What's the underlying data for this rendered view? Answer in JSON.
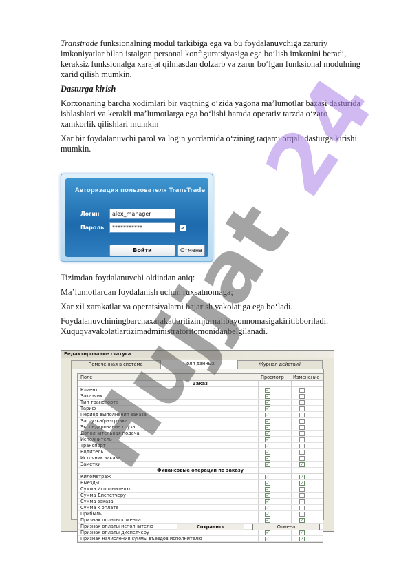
{
  "intro": {
    "term": "Transtrade",
    "rest": " funksionalning modul tarkibiga ega va bu foydalanuvchiga zaruriy imkoniyatlar bilan istalgan personal konfiguratsiyasiga ega bo‘lish imkonini beradi, keraksiz funksionalga xarajat qilmasdan dolzarb va zarur bo‘lgan funksional modulning xarid qilish mumkin."
  },
  "heading": "Dasturga kirish",
  "para1": "Korxonaning barcha xodimlari bir vaqtning o‘zida yagona ma’lumotlar bazasi dasturida ishlashlari va kerakli ma’lumotlarga ega bo‘lishi hamda operativ tarzda o‘zaro xamkorlik qilishlari mumkin",
  "para2": "Xar bir foydalanuvchi parol va login yordamida o‘zining  raqami orqali dasturga kirishi mumkin.",
  "login": {
    "title": "Авторизация пользователя TransTrade",
    "login_label": "Логин",
    "login_value": "alex_manager",
    "password_label": "Пароль",
    "password_value": "***********",
    "check_mark": "✔",
    "ok_label": "Войти",
    "cancel_label": "Отмена"
  },
  "para3": "Tizimdan foydalanuvchi oldindan aniq:",
  "para4": "Ma’lumotlardan foydalanish uchun  ruxsatnomaga;",
  "para5": " Xar xil xarakatlar va operatsiyalarni bajarish vakolatiga ega bo‘ladi.",
  "para6": " Foydalanuvchiningbarchaxarakatlaritizimjurnalibayonnomasigakiritibboriladi. Xuquqvavakolatlartizimadministratoritomonidanbelgilanadi.",
  "editor": {
    "title": "Редактирование статуса",
    "tabs": [
      "Помеченная в системе",
      "Поля данных",
      "Журнал действий"
    ],
    "col_field": "Поле",
    "col_view": "Просмотр",
    "col_edit": "Изменение",
    "section1": "Заказ",
    "rows1": [
      {
        "name": "Клиент",
        "view": true,
        "edit": false
      },
      {
        "name": "Заказчик",
        "view": true,
        "edit": false
      },
      {
        "name": "Тип транспорта",
        "view": true,
        "edit": false
      },
      {
        "name": "Тариф",
        "view": true,
        "edit": false
      },
      {
        "name": "Период выполнения заказа",
        "view": true,
        "edit": false
      },
      {
        "name": "Загрузка/разгрузка",
        "view": true,
        "edit": false
      },
      {
        "name": "Экспедирование груза",
        "view": true,
        "edit": false
      },
      {
        "name": "Дополнительная подача",
        "view": true,
        "edit": false
      },
      {
        "name": "Исполнитель",
        "view": true,
        "edit": false
      },
      {
        "name": "Транспорт",
        "view": true,
        "edit": false
      },
      {
        "name": "Водитель",
        "view": true,
        "edit": false
      },
      {
        "name": "Источник заказа",
        "view": true,
        "edit": false
      },
      {
        "name": "Заметки",
        "view": true,
        "edit": true
      }
    ],
    "section2": "Финансовые операции по заказу",
    "rows2": [
      {
        "name": "Километраж",
        "view": true,
        "edit": true
      },
      {
        "name": "Выезды",
        "view": true,
        "edit": true
      },
      {
        "name": "Сумма Исполнителю",
        "view": true,
        "edit": false
      },
      {
        "name": "Сумма Диспетчеру",
        "view": true,
        "edit": false
      },
      {
        "name": "Сумма заказа",
        "view": true,
        "edit": false
      },
      {
        "name": "Сумма к оплате",
        "view": true,
        "edit": false
      },
      {
        "name": "Прибыль",
        "view": true,
        "edit": false
      },
      {
        "name": "Признак оплаты клиента",
        "view": true,
        "edit": true
      },
      {
        "name": "Признак оплаты исполнителю",
        "view": true,
        "edit": true
      },
      {
        "name": "Признак оплаты диспетчеру",
        "view": true,
        "edit": true
      },
      {
        "name": "Признак начисления суммы въездов исполнителю",
        "view": true,
        "edit": true
      }
    ],
    "save_label": "Сохранить",
    "cancel_label": "Отмена"
  },
  "watermark": "Hujjat 24"
}
